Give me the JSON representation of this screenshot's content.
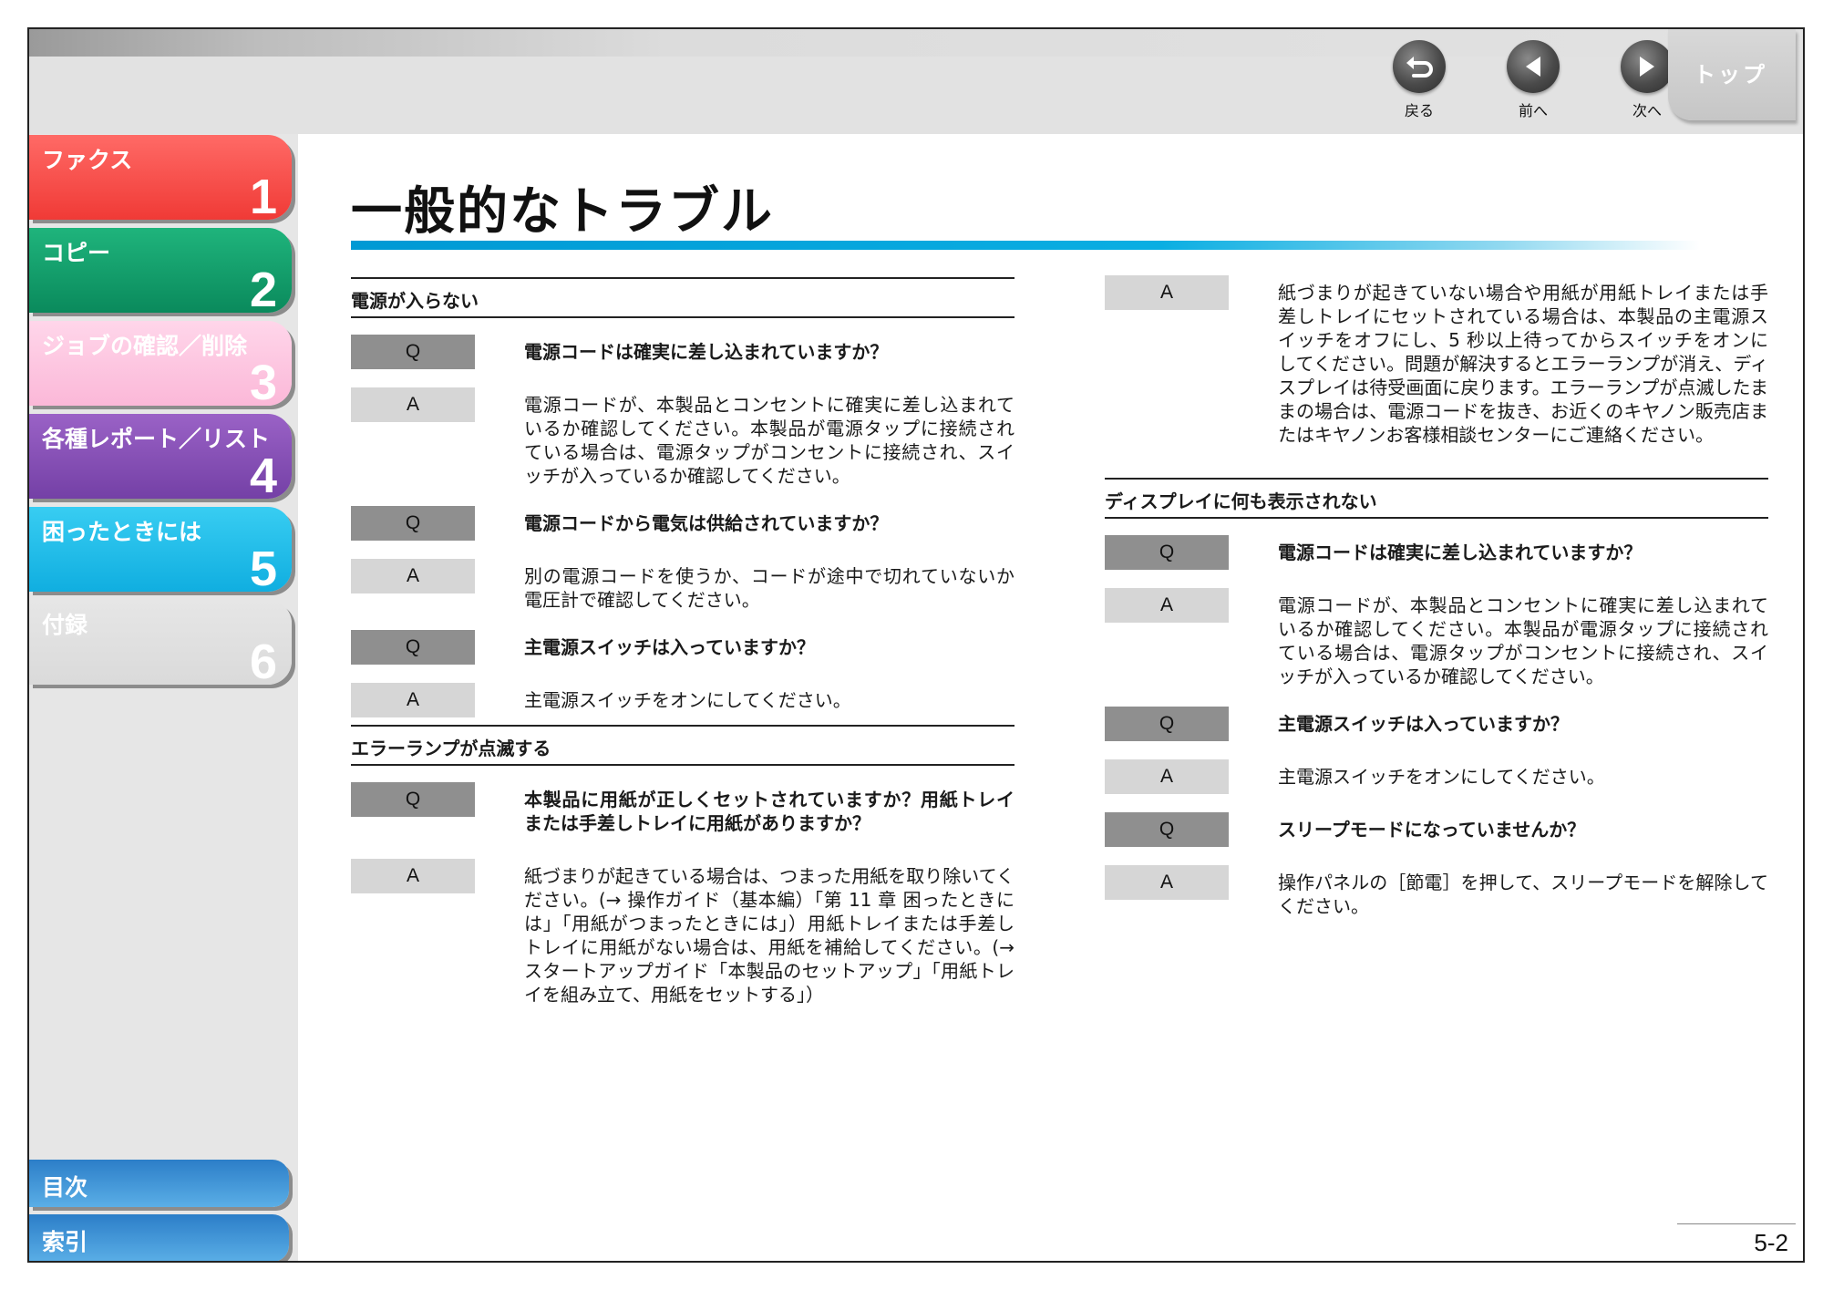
{
  "nav": {
    "back_label": "戻る",
    "prev_label": "前へ",
    "next_label": "次へ",
    "top_label": "トップ"
  },
  "sidebar": {
    "chapters": [
      {
        "label": "ファクス",
        "num": "1"
      },
      {
        "label": "コピー",
        "num": "2"
      },
      {
        "label": "ジョブの確認／削除",
        "num": "3"
      },
      {
        "label": "各種レポート／リスト",
        "num": "4"
      },
      {
        "label": "困ったときには",
        "num": "5"
      },
      {
        "label": "付録",
        "num": "6"
      }
    ],
    "contents_label": "目次",
    "index_label": "索引"
  },
  "page": {
    "title": "一般的なトラブル",
    "page_number": "5-2"
  },
  "left": {
    "sections": [
      {
        "heading": "電源が入らない",
        "qa": [
          {
            "tag": "Q",
            "text": "電源コードは確実に差し込まれていますか？"
          },
          {
            "tag": "A",
            "text": "電源コードが、本製品とコンセントに確実に差し込まれているか確認してください。本製品が電源タップに接続されている場合は、電源タップがコンセントに接続され、スイッチが入っているか確認してください。"
          },
          {
            "tag": "Q",
            "text": "電源コードから電気は供給されていますか？"
          },
          {
            "tag": "A",
            "text": "別の電源コードを使うか、コードが途中で切れていないか電圧計で確認してください。"
          },
          {
            "tag": "Q",
            "text": "主電源スイッチは入っていますか？"
          },
          {
            "tag": "A",
            "text": "主電源スイッチをオンにしてください。"
          }
        ]
      },
      {
        "heading": "エラーランプが点滅する",
        "qa": [
          {
            "tag": "Q",
            "text": "本製品に用紙が正しくセットされていますか？用紙トレイまたは手差しトレイに用紙がありますか？"
          },
          {
            "tag": "A",
            "text": "紙づまりが起きている場合は、つまった用紙を取り除いてください。(→ 操作ガイド（基本編）「第 11 章 困ったときには」「用紙がつまったときには」）用紙トレイまたは手差しトレイに用紙がない場合は、用紙を補給してください。(→ スタートアップガイド「本製品のセットアップ」「用紙トレイを組み立て、用紙をセットする」）"
          }
        ]
      }
    ]
  },
  "right": {
    "continued": {
      "tag": "A",
      "text": "紙づまりが起きていない場合や用紙が用紙トレイまたは手差しトレイにセットされている場合は、本製品の主電源スイッチをオフにし、5 秒以上待ってからスイッチをオンにしてください。問題が解決するとエラーランプが消え、ディスプレイは待受画面に戻ります。エラーランプが点滅したままの場合は、電源コードを抜き、お近くのキヤノン販売店またはキヤノンお客様相談センターにご連絡ください。"
    },
    "sections": [
      {
        "heading": "ディスプレイに何も表示されない",
        "qa": [
          {
            "tag": "Q",
            "text": "電源コードは確実に差し込まれていますか？"
          },
          {
            "tag": "A",
            "text": "電源コードが、本製品とコンセントに確実に差し込まれているか確認してください。本製品が電源タップに接続されている場合は、電源タップがコンセントに接続され、スイッチが入っているか確認してください。"
          },
          {
            "tag": "Q",
            "text": "主電源スイッチは入っていますか？"
          },
          {
            "tag": "A",
            "text": "主電源スイッチをオンにしてください。"
          },
          {
            "tag": "Q",
            "text": "スリープモードになっていませんか？"
          },
          {
            "tag": "A",
            "text": "操作パネルの［節電］を押して、スリープモードを解除してください。"
          }
        ]
      }
    ]
  },
  "colors": {
    "chapter1": "#f03a36",
    "chapter2": "#0a8a5c",
    "chapter3": "#fbb8d8",
    "chapter4": "#7440a6",
    "chapter5": "#10aee0",
    "chapter6": "#dadada",
    "title_bar": "#0099d4",
    "q_tag": "#8f8f8f",
    "a_tag": "#d6d6d6"
  },
  "icons": {
    "back": "return-arrow-icon",
    "prev": "left-triangle-icon",
    "next": "right-triangle-icon"
  }
}
